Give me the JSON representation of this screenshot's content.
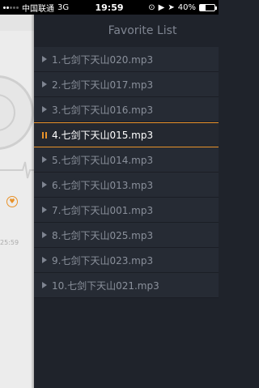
{
  "status_bar": {
    "carrier": "中国联通",
    "network": "3G",
    "time": "19:59",
    "battery": "40%",
    "battery_level": 0.4
  },
  "player": {
    "time_partial": "25:59"
  },
  "playlist": {
    "title": "Favorite List",
    "active_index": 3,
    "tracks": [
      "1.七剑下天山020.mp3",
      "2.七剑下天山017.mp3",
      "3.七剑下天山016.mp3",
      "4.七剑下天山015.mp3",
      "5.七剑下天山014.mp3",
      "6.七剑下天山013.mp3",
      "7.七剑下天山001.mp3",
      "8.七剑下天山025.mp3",
      "9.七剑下天山023.mp3",
      "10.七剑下天山021.mp3"
    ]
  },
  "colors": {
    "accent": "#e8922a",
    "list_bg": "#1f232b",
    "row_bg": "#262b34"
  },
  "icons": {
    "play": "play-triangle-icon",
    "pause": "pause-icon",
    "favorite": "heart-icon"
  }
}
